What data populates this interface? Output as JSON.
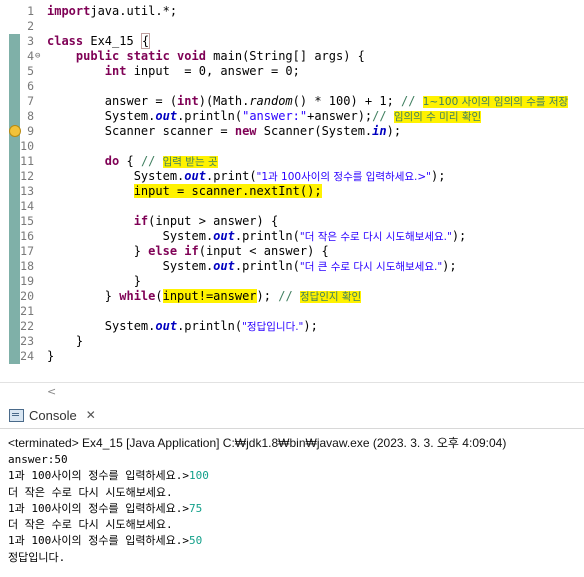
{
  "editor": {
    "lines": [
      {
        "n": "1",
        "parts": [
          [
            "kw",
            "import"
          ],
          [
            "",
            "java.util.*;"
          ]
        ]
      },
      {
        "n": "2",
        "parts": []
      },
      {
        "n": "3",
        "parts": [
          [
            "kw",
            "class"
          ],
          [
            "",
            " Ex4_15 "
          ],
          [
            "bracket",
            "{"
          ]
        ]
      },
      {
        "n": "4",
        "fold": "⊖",
        "parts": [
          [
            "",
            "    "
          ],
          [
            "kw",
            "public static void"
          ],
          [
            "",
            " main(String[] args) {"
          ]
        ]
      },
      {
        "n": "5",
        "parts": [
          [
            "",
            "        "
          ],
          [
            "kw",
            "int"
          ],
          [
            "",
            " input  = 0, answer = 0;"
          ]
        ]
      },
      {
        "n": "6",
        "parts": []
      },
      {
        "n": "7",
        "parts": [
          [
            "",
            "        answer = ("
          ],
          [
            "kw",
            "int"
          ],
          [
            "",
            ")(Math."
          ],
          [
            "italic",
            "random"
          ],
          [
            "",
            "() * 100) + 1; "
          ],
          [
            "cm",
            "// "
          ],
          [
            "hlcm",
            "1~100 사이의 임의의 수를 저장"
          ]
        ]
      },
      {
        "n": "8",
        "parts": [
          [
            "",
            "        System."
          ],
          [
            "itstatic",
            "out"
          ],
          [
            "",
            ".println("
          ],
          [
            "str",
            "\"answer:\""
          ],
          [
            "",
            "+answer);"
          ],
          [
            "cm",
            "// "
          ],
          [
            "hlcm",
            "임의의 수 미리 확인"
          ]
        ]
      },
      {
        "n": "9",
        "parts": [
          [
            "",
            "        Scanner "
          ],
          [
            "",
            "scanner"
          ],
          [
            "",
            " = "
          ],
          [
            "kw",
            "new"
          ],
          [
            "",
            " Scanner(System."
          ],
          [
            "itstatic",
            "in"
          ],
          [
            "",
            "); "
          ]
        ]
      },
      {
        "n": "10",
        "parts": []
      },
      {
        "n": "11",
        "parts": [
          [
            "",
            "        "
          ],
          [
            "kw",
            "do"
          ],
          [
            "",
            " { "
          ],
          [
            "cm",
            "// "
          ],
          [
            "hlcm",
            "입력 받는 곳"
          ]
        ]
      },
      {
        "n": "12",
        "parts": [
          [
            "",
            "            System."
          ],
          [
            "itstatic",
            "out"
          ],
          [
            "",
            ".print("
          ],
          [
            "str",
            "\"1과 100사이의 정수를 입력하세요.>\""
          ],
          [
            "",
            ");"
          ]
        ]
      },
      {
        "n": "13",
        "parts": [
          [
            "",
            "            "
          ],
          [
            "hl",
            "input = scanner.nextInt();"
          ]
        ]
      },
      {
        "n": "14",
        "parts": []
      },
      {
        "n": "15",
        "parts": [
          [
            "",
            "            "
          ],
          [
            "kw",
            "if"
          ],
          [
            "",
            "(input > answer) {"
          ]
        ]
      },
      {
        "n": "16",
        "parts": [
          [
            "",
            "                System."
          ],
          [
            "itstatic",
            "out"
          ],
          [
            "",
            ".println("
          ],
          [
            "str",
            "\"더 작은 수로 다시 시도해보세요.\""
          ],
          [
            "",
            ");"
          ]
        ]
      },
      {
        "n": "17",
        "parts": [
          [
            "",
            "            } "
          ],
          [
            "kw",
            "else if"
          ],
          [
            "",
            "(input < answer) {"
          ]
        ]
      },
      {
        "n": "18",
        "parts": [
          [
            "",
            "                System."
          ],
          [
            "itstatic",
            "out"
          ],
          [
            "",
            ".println("
          ],
          [
            "str",
            "\"더 큰 수로 다시 시도해보세요.\""
          ],
          [
            "",
            ");"
          ]
        ]
      },
      {
        "n": "19",
        "parts": [
          [
            "",
            "            }"
          ]
        ]
      },
      {
        "n": "20",
        "parts": [
          [
            "",
            "        } "
          ],
          [
            "kw",
            "while"
          ],
          [
            "",
            "("
          ],
          [
            "hl",
            "input!=answer"
          ],
          [
            "",
            "); "
          ],
          [
            "cm",
            "// "
          ],
          [
            "hlcm",
            "정답인지 확인"
          ]
        ]
      },
      {
        "n": "21",
        "parts": []
      },
      {
        "n": "22",
        "parts": [
          [
            "",
            "        System."
          ],
          [
            "itstatic",
            "out"
          ],
          [
            "",
            ".println("
          ],
          [
            "str",
            "\"정답입니다.\""
          ],
          [
            "",
            ");"
          ]
        ]
      },
      {
        "n": "23",
        "parts": [
          [
            "",
            "    }"
          ]
        ]
      },
      {
        "n": "24",
        "parts": [
          [
            "",
            "}"
          ]
        ]
      }
    ]
  },
  "console": {
    "tab_label": "Console",
    "close_glyph": "✕",
    "status": "<terminated> Ex4_15 [Java Application] C:₩jdk1.8₩bin₩javaw.exe (2023. 3. 3. 오후 4:09:04)",
    "output": [
      {
        "text": "answer:50",
        "input": ""
      },
      {
        "text": "1과 100사이의 정수를 입력하세요.>",
        "input": "100"
      },
      {
        "text": "더 작은 수로 다시 시도해보세요.",
        "input": ""
      },
      {
        "text": "1과 100사이의 정수를 입력하세요.>",
        "input": "75"
      },
      {
        "text": "더 작은 수로 다시 시도해보세요.",
        "input": ""
      },
      {
        "text": "1과 100사이의 정수를 입력하세요.>",
        "input": "50"
      },
      {
        "text": "정답입니다.",
        "input": ""
      }
    ]
  },
  "colors": {
    "keyword": "#7f0055",
    "string": "#2a00ff",
    "comment": "#3f7f5f",
    "highlight": "#fff200",
    "user_input": "#13a08a"
  }
}
